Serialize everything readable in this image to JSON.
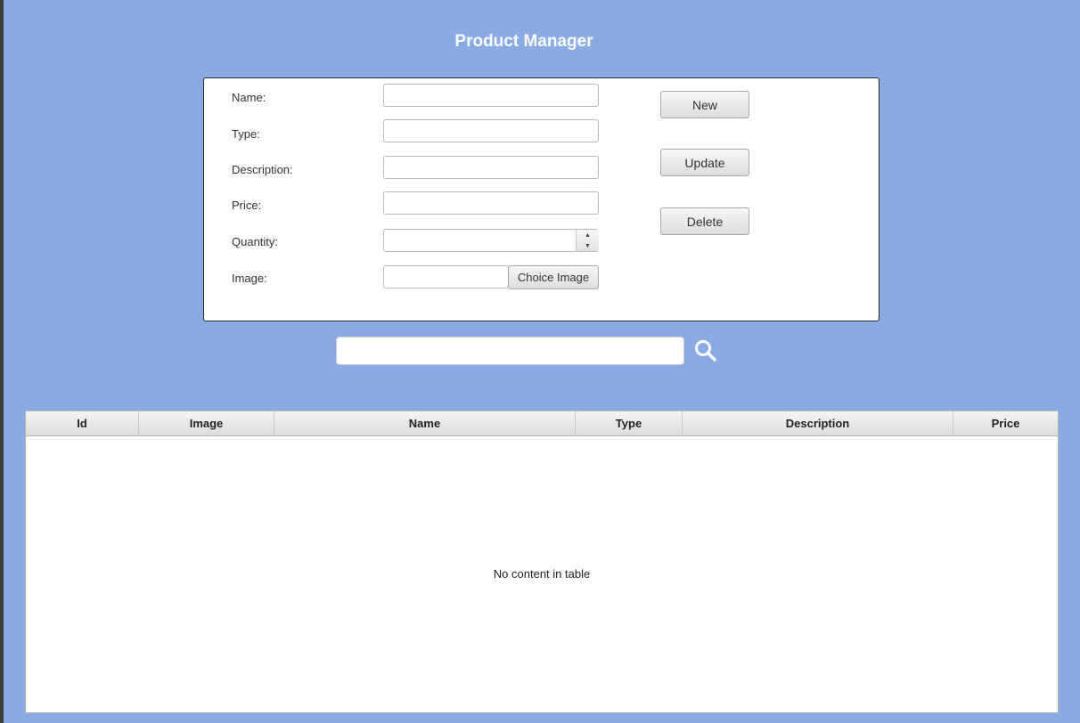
{
  "app": {
    "title": "Product Manager"
  },
  "form": {
    "name_label": "Name:",
    "type_label": "Type:",
    "description_label": "Description:",
    "price_label": "Price:",
    "quantity_label": "Quantity:",
    "image_label": "Image:",
    "name_value": "",
    "type_value": "",
    "description_value": "",
    "price_value": "",
    "quantity_value": "",
    "image_value": "",
    "choice_image_label": "Choice Image"
  },
  "actions": {
    "new_label": "New",
    "update_label": "Update",
    "delete_label": "Delete"
  },
  "search": {
    "value": "",
    "icon": "search-icon"
  },
  "table": {
    "columns": [
      "Id",
      "Image",
      "Name",
      "Type",
      "Description",
      "Price"
    ],
    "rows": [],
    "empty_message": "No content in table"
  },
  "colors": {
    "background": "#8aaae4",
    "panel": "#ffffff",
    "title": "#ffffff"
  }
}
